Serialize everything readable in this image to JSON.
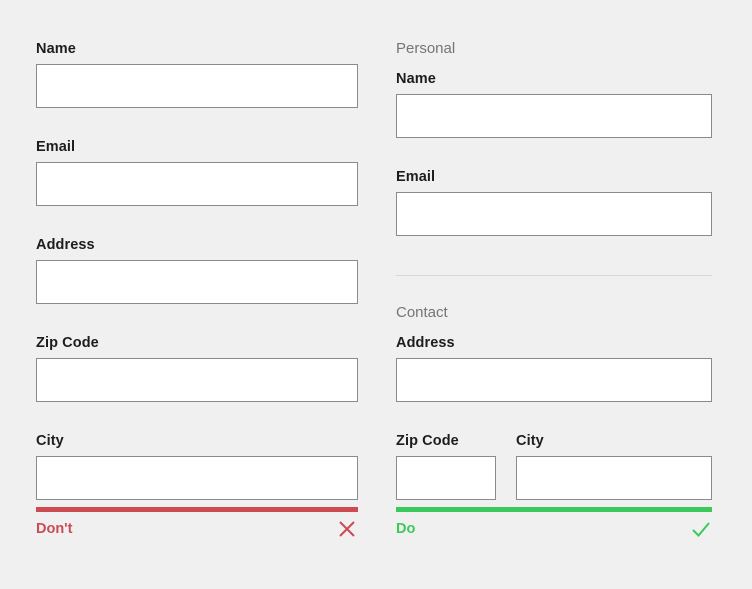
{
  "page": {
    "background_color": "#f0f0f0",
    "input_border_color": "#8a8a8a",
    "input_background_color": "#ffffff",
    "label_color": "#1d1d1d",
    "section_heading_color": "#757575",
    "divider_color": "#d7d7d7",
    "bad_color": "#cc4a52",
    "good_color": "#3cc95b"
  },
  "dont_example": {
    "fields": [
      {
        "label": "Name",
        "value": "",
        "placeholder": ""
      },
      {
        "label": "Email",
        "value": "",
        "placeholder": ""
      },
      {
        "label": "Address",
        "value": "",
        "placeholder": ""
      },
      {
        "label": "Zip Code",
        "value": "",
        "placeholder": ""
      },
      {
        "label": "City",
        "value": "",
        "placeholder": ""
      }
    ],
    "verdict": {
      "label": "Don't",
      "icon": "cross-icon",
      "color": "#cc4a52"
    }
  },
  "do_example": {
    "sections": [
      {
        "heading": "Personal",
        "fields": [
          {
            "label": "Name",
            "value": "",
            "placeholder": ""
          },
          {
            "label": "Email",
            "value": "",
            "placeholder": ""
          }
        ]
      },
      {
        "heading": "Contact",
        "fields": [
          {
            "label": "Address",
            "value": "",
            "placeholder": ""
          },
          {
            "label": "Zip Code",
            "value": "",
            "placeholder": ""
          },
          {
            "label": "City",
            "value": "",
            "placeholder": ""
          }
        ]
      }
    ],
    "verdict": {
      "label": "Do",
      "icon": "check-icon",
      "color": "#3cc95b"
    }
  }
}
